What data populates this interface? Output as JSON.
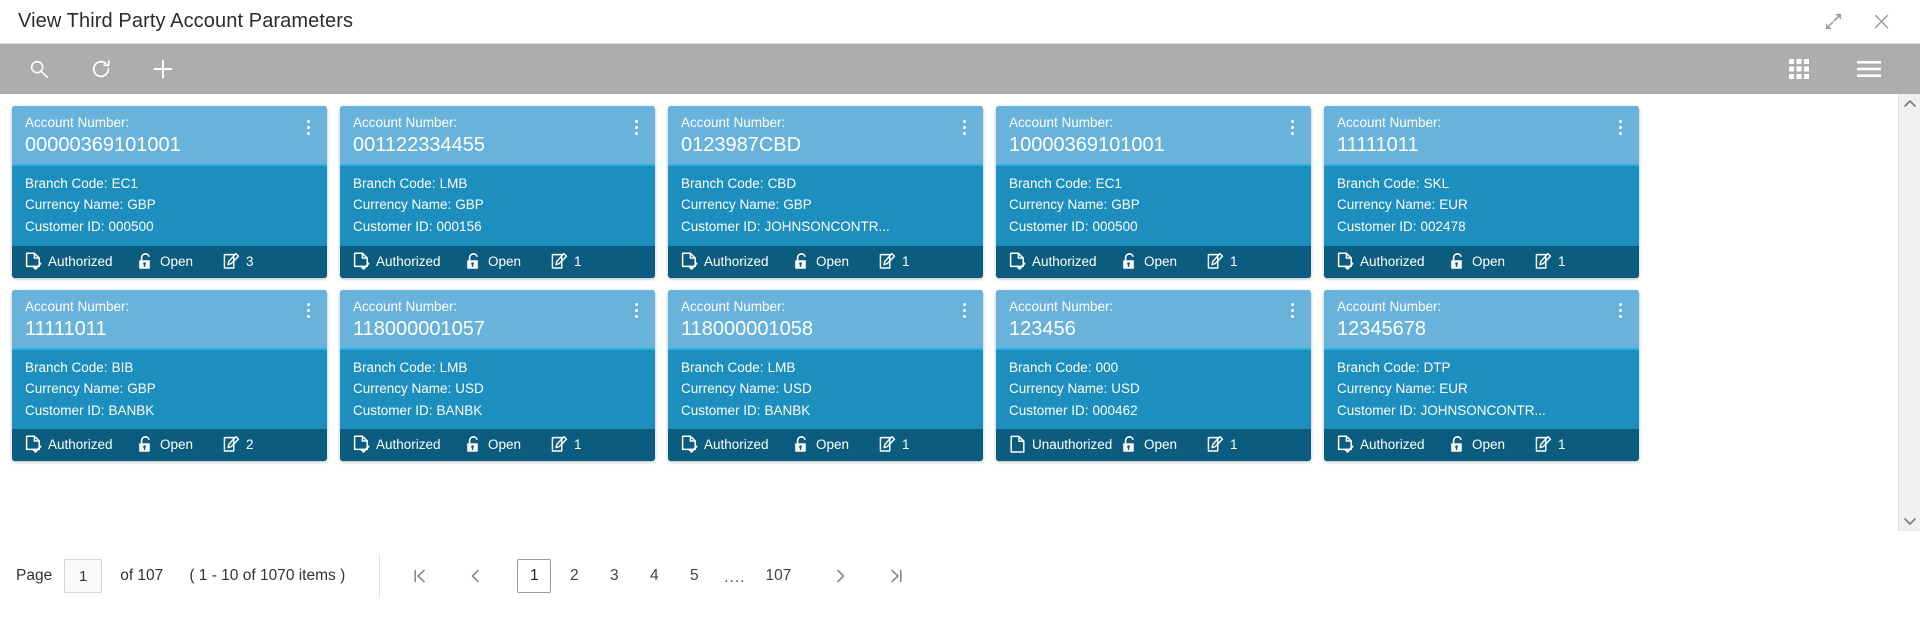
{
  "window": {
    "title": "View Third Party Account Parameters",
    "actions": [
      {
        "name": "restore-down-icon",
        "label": "Restore Down"
      },
      {
        "name": "close-icon",
        "label": "Close"
      }
    ]
  },
  "toolbar": {
    "left": [
      {
        "name": "search-icon",
        "label": "Search"
      },
      {
        "name": "refresh-icon",
        "label": "Refresh"
      },
      {
        "name": "add-icon",
        "label": "Add"
      }
    ],
    "right": [
      {
        "name": "grid-view-icon",
        "label": "Tile View"
      },
      {
        "name": "list-view-icon",
        "label": "List View"
      }
    ]
  },
  "card_labels": {
    "account_number": "Account Number:",
    "branch_code": "Branch Code:",
    "currency_name": "Currency Name:",
    "customer_id": "Customer ID:"
  },
  "cards": [
    {
      "account_number": "00000369101001",
      "branch_code": "EC1",
      "currency_name": "GBP",
      "customer_id": "000500",
      "status": "Authorized",
      "lock_state": "Open",
      "mod_number": "3"
    },
    {
      "account_number": "001122334455",
      "branch_code": "LMB",
      "currency_name": "GBP",
      "customer_id": "000156",
      "status": "Authorized",
      "lock_state": "Open",
      "mod_number": "1"
    },
    {
      "account_number": "0123987CBD",
      "branch_code": "CBD",
      "currency_name": "GBP",
      "customer_id": "JOHNSONCONTR...",
      "status": "Authorized",
      "lock_state": "Open",
      "mod_number": "1"
    },
    {
      "account_number": "10000369101001",
      "branch_code": "EC1",
      "currency_name": "GBP",
      "customer_id": "000500",
      "status": "Authorized",
      "lock_state": "Open",
      "mod_number": "1"
    },
    {
      "account_number": "11111011",
      "branch_code": "SKL",
      "currency_name": "EUR",
      "customer_id": "002478",
      "status": "Authorized",
      "lock_state": "Open",
      "mod_number": "1"
    },
    {
      "account_number": "11111011",
      "branch_code": "BIB",
      "currency_name": "GBP",
      "customer_id": "BANBK",
      "status": "Authorized",
      "lock_state": "Open",
      "mod_number": "2"
    },
    {
      "account_number": "118000001057",
      "branch_code": "LMB",
      "currency_name": "USD",
      "customer_id": "BANBK",
      "status": "Authorized",
      "lock_state": "Open",
      "mod_number": "1"
    },
    {
      "account_number": "118000001058",
      "branch_code": "LMB",
      "currency_name": "USD",
      "customer_id": "BANBK",
      "status": "Authorized",
      "lock_state": "Open",
      "mod_number": "1"
    },
    {
      "account_number": "123456",
      "branch_code": "000",
      "currency_name": "USD",
      "customer_id": "000462",
      "status": "Unauthorized",
      "lock_state": "Open",
      "mod_number": "1"
    },
    {
      "account_number": "12345678",
      "branch_code": "DTP",
      "currency_name": "EUR",
      "customer_id": "JOHNSONCONTR...",
      "status": "Authorized",
      "lock_state": "Open",
      "mod_number": "1"
    }
  ],
  "pagination": {
    "page_label": "Page",
    "page_value": "1",
    "of_text": "of 107",
    "range_text": "( 1 - 10 of 1070 items )",
    "pages": [
      "1",
      "2",
      "3",
      "4",
      "5"
    ],
    "ellipsis": "....",
    "last_page": "107",
    "active_page": "1",
    "first_icon": "first-page-icon",
    "prev_icon": "prev-page-icon",
    "next_icon": "next-page-icon",
    "last_icon": "last-page-icon"
  },
  "colors": {
    "card_header": "#69b3db",
    "card_body": "#1d8fbf",
    "card_footer": "#0c5c80",
    "card_accent": "#29b2e4",
    "toolbar_bg": "#adadad"
  }
}
